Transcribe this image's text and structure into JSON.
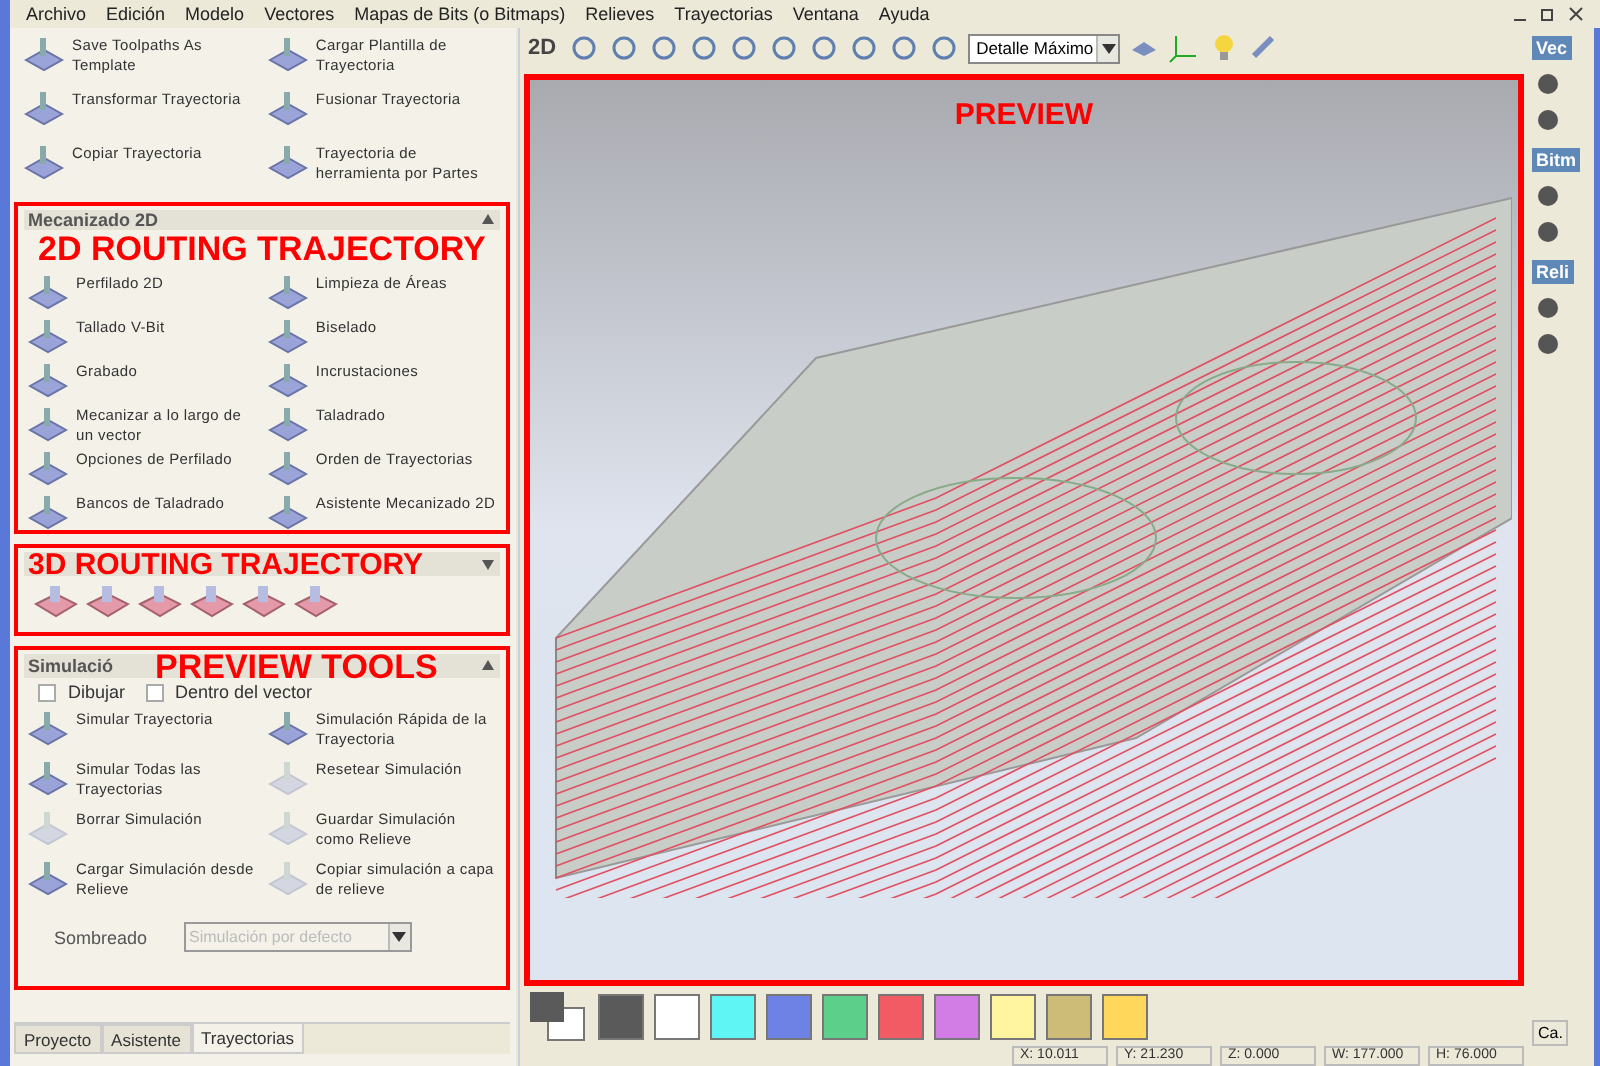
{
  "menu": {
    "items": [
      "Archivo",
      "Edición",
      "Modelo",
      "Vectores",
      "Mapas de Bits (o Bitmaps)",
      "Relieves",
      "Trayectorias",
      "Ventana",
      "Ayuda"
    ]
  },
  "toolpath_ops": [
    {
      "label": "Save Toolpaths As Template"
    },
    {
      "label": "Cargar Plantilla de Trayectoria"
    },
    {
      "label": "Transformar Trayectoria"
    },
    {
      "label": "Fusionar Trayectoria"
    },
    {
      "label": "Copiar Trayectoria"
    },
    {
      "label": "Trayectoria de herramienta por Partes"
    }
  ],
  "machining_2d": {
    "title": "Mecanizado 2D",
    "annotation": "2D ROUTING TRAJECTORY",
    "items": [
      {
        "label": "Perfilado 2D"
      },
      {
        "label": "Limpieza de Áreas"
      },
      {
        "label": "Tallado V-Bit"
      },
      {
        "label": "Biselado"
      },
      {
        "label": "Grabado"
      },
      {
        "label": "Incrustaciones"
      },
      {
        "label": "Mecanizar a lo largo de un vector"
      },
      {
        "label": "Taladrado"
      },
      {
        "label": "Opciones de Perfilado"
      },
      {
        "label": "Orden de Trayectorias"
      },
      {
        "label": "Bancos de Taladrado"
      },
      {
        "label": "Asistente Mecanizado 2D"
      }
    ]
  },
  "machining_3d": {
    "annotation": "3D ROUTING TRAJECTORY"
  },
  "simulation": {
    "title": "Simulació",
    "annotation": "PREVIEW TOOLS",
    "checkboxes": [
      {
        "label": "Dibujar",
        "checked": false
      },
      {
        "label": "Dentro del vector",
        "checked": false
      }
    ],
    "items": [
      {
        "label": "Simular Trayectoria",
        "disabled": false
      },
      {
        "label": "Simulación Rápida de la Trayectoria",
        "disabled": false
      },
      {
        "label": "Simular Todas las Trayectorias",
        "disabled": false
      },
      {
        "label": "Resetear Simulación",
        "disabled": true
      },
      {
        "label": "Borrar Simulación",
        "disabled": true
      },
      {
        "label": "Guardar Simulación como Relieve",
        "disabled": true
      },
      {
        "label": "Cargar Simulación desde Relieve",
        "disabled": false
      },
      {
        "label": "Copiar simulación a capa de relieve",
        "disabled": true
      }
    ],
    "shading": {
      "label": "Sombreado",
      "value": "Simulación por defecto",
      "disabled": true
    }
  },
  "panel_tabs": [
    {
      "label": "Proyecto",
      "selected": false
    },
    {
      "label": "Asistente",
      "selected": false
    },
    {
      "label": "Trayectorias",
      "selected": true
    }
  ],
  "toolbar": {
    "view_label": "2D",
    "detail": "Detalle Máximo"
  },
  "preview": {
    "annotation": "PREVIEW"
  },
  "palette": {
    "swatches": [
      {
        "color": "#5a5a5a"
      },
      {
        "color": "#ffffff"
      },
      {
        "color": "#5ff5f5"
      },
      {
        "color": "#6e82e6"
      },
      {
        "color": "#5ccf8a"
      },
      {
        "color": "#f25a64"
      },
      {
        "color": "#d27de6"
      },
      {
        "color": "#fff5a0"
      },
      {
        "color": "#cdbb78"
      },
      {
        "color": "#ffd75a"
      }
    ]
  },
  "status_bar": [
    "X: 10.011",
    "Y: 21.230",
    "Z: 0.000",
    "W: 177.000",
    "H: 76.000"
  ],
  "right_panel": {
    "sections": [
      {
        "title": "Vec"
      },
      {
        "title": "Bitm"
      },
      {
        "title": "Reli"
      }
    ],
    "tab": "Ca."
  }
}
